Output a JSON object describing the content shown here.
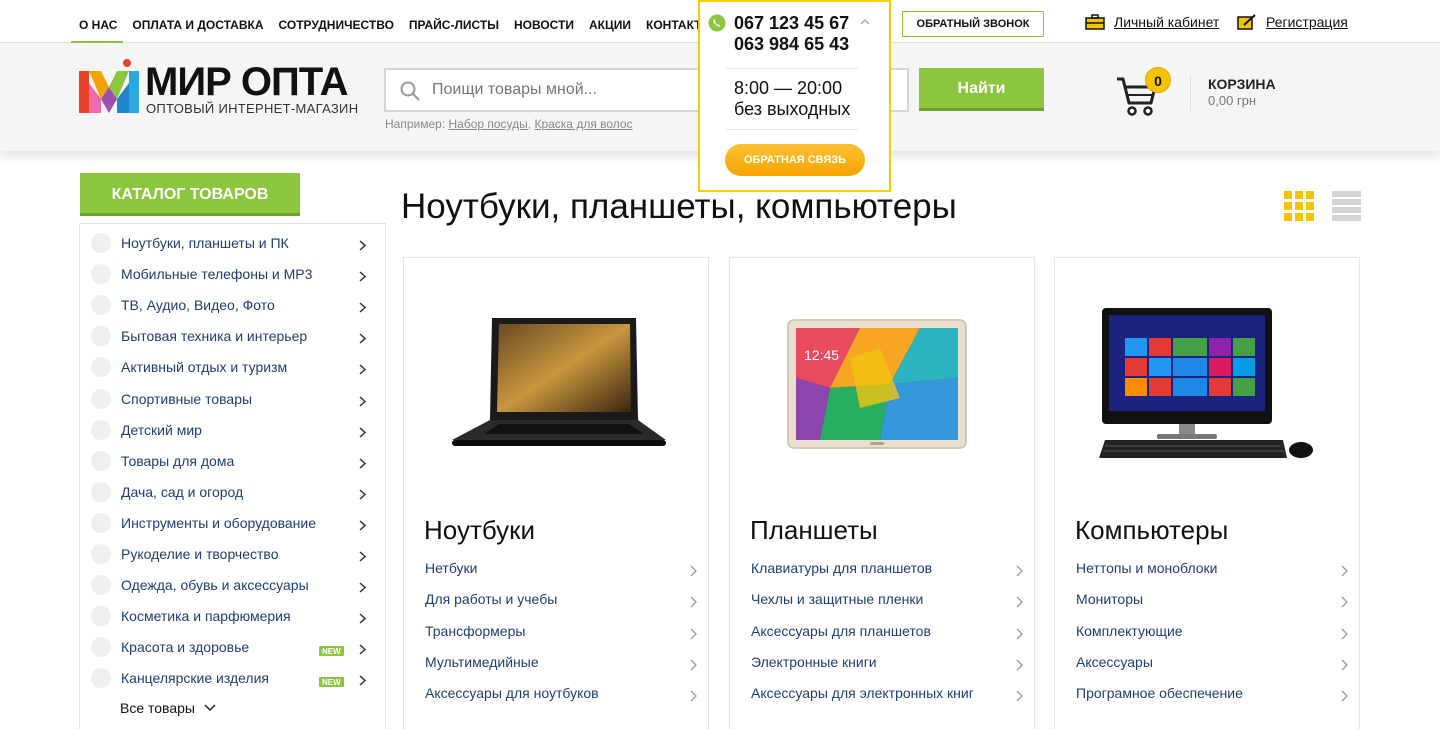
{
  "topnav": {
    "items": [
      "О НАС",
      "ОПЛАТА И ДОСТАВКА",
      "СОТРУДНИЧЕСТВО",
      "ПРАЙС-ЛИСТЫ",
      "НОВОСТИ",
      "АКЦИИ",
      "КОНТАКТЫ"
    ],
    "active_index": 0,
    "callback_label": "ОБРАТНЫЙ ЗВОНОК",
    "cabinet_label": "Личный кабинет",
    "register_label": "Регистрация"
  },
  "contacts_popup": {
    "phone1": "067 123 45 67",
    "phone2": "063 984 65 43",
    "hours": "8:00 — 20:00",
    "days": "без выходных",
    "feedback_label": "ОБРАТНАЯ СВЯЗЬ"
  },
  "header": {
    "logo_name": "МИР ОПТА",
    "logo_sub": "ОПТОВЫЙ ИНТЕРНЕТ-МАГАЗИН",
    "search_placeholder": "Поищи товары мной...",
    "example_prefix": "Например: ",
    "example_1": "Набор посуды",
    "example_sep": ", ",
    "example_2": "Краска для волос",
    "find_label": "Найти",
    "cart_count": "0",
    "cart_title": "КОРЗИНА",
    "cart_sum": "0,00 грн"
  },
  "sidebar": {
    "catalog_label": "КАТАЛОГ ТОВАРОВ",
    "items": [
      {
        "label": "Ноутбуки, планшеты и ПК",
        "new": false
      },
      {
        "label": "Мобильные телефоны и MP3",
        "new": false
      },
      {
        "label": "ТВ, Аудио, Видео, Фото",
        "new": false
      },
      {
        "label": "Бытовая техника и интерьер",
        "new": false
      },
      {
        "label": "Активный отдых и туризм",
        "new": false
      },
      {
        "label": "Спортивные товары",
        "new": false
      },
      {
        "label": "Детский мир",
        "new": false
      },
      {
        "label": "Товары для дома",
        "new": false
      },
      {
        "label": "Дача, сад и огород",
        "new": false
      },
      {
        "label": "Инструменты и оборудование",
        "new": false
      },
      {
        "label": "Рукоделие и творчество",
        "new": false
      },
      {
        "label": "Одежда, обувь и аксессуары",
        "new": false
      },
      {
        "label": "Косметика и парфюмерия",
        "new": false
      },
      {
        "label": "Красота и здоровье",
        "new": true
      },
      {
        "label": "Канцелярские изделия",
        "new": true
      }
    ],
    "new_badge": "NEW",
    "all_goods_label": "Все товары"
  },
  "main": {
    "title": "Ноутбуки, планшеты, компьютеры",
    "cards": [
      {
        "title": "Ноутбуки",
        "image": "laptop",
        "links": [
          "Нетбуки",
          "Для работы и учебы",
          "Трансформеры",
          "Мультимедийные",
          "Аксессуары для ноутбуков"
        ]
      },
      {
        "title": "Планшеты",
        "image": "tablet",
        "links": [
          "Клавиатуры для планшетов",
          "Чехлы и защитные пленки",
          "Аксессуары для планшетов",
          "Электронные книги",
          "Аксессуары для электронных книг"
        ]
      },
      {
        "title": "Компьютеры",
        "image": "desktop",
        "links": [
          "Неттопы и моноблоки",
          "Мониторы",
          "Комплектующие",
          "Аксессуары",
          "Програмное обеспечение"
        ]
      }
    ]
  },
  "colors": {
    "accent": "#8cc63f",
    "badge": "#f5c400",
    "popup_border": "#f5d000",
    "link": "#1c3f70"
  }
}
